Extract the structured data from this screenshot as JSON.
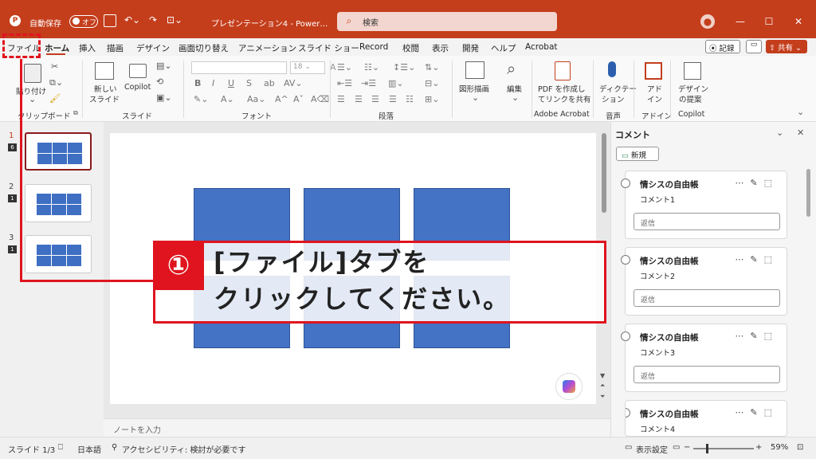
{
  "titlebar": {
    "autosave_label": "自動保存",
    "autosave_state": "オフ",
    "doc_title": "プレゼンテーション4 - Power…",
    "search_placeholder": "検索"
  },
  "tabs": [
    "ファイル",
    "ホーム",
    "挿入",
    "描画",
    "デザイン",
    "画面切り替え",
    "アニメーション",
    "スライド ショー",
    "Record",
    "校閲",
    "表示",
    "開発",
    "ヘルプ",
    "Acrobat"
  ],
  "tab_actions": {
    "record": "記録",
    "share": "共有"
  },
  "ribbon": {
    "paste": "貼り付け",
    "clipboard_group": "クリップボード",
    "new_slide": "新しい",
    "new_slide2": "スライド",
    "copilot": "Copilot",
    "slides_group": "スライド",
    "font_size": "18",
    "font_group": "フォント",
    "paragraph_group": "段落",
    "shape_draw": "図形描画",
    "edit": "編集",
    "pdf1": "PDF を作成し",
    "pdf2": "てリンクを共有",
    "acrobat_group": "Adobe Acrobat",
    "dictate1": "ディクテー",
    "dictate2": "ション",
    "voice_group": "音声",
    "addin1": "アド",
    "addin2": "イン",
    "addin_group": "アドイン",
    "designer1": "デザイン",
    "designer2": "の提案",
    "copilot_group": "Copilot"
  },
  "thumbnails": [
    {
      "num": "1",
      "comments": "6"
    },
    {
      "num": "2",
      "comments": "1"
    },
    {
      "num": "3",
      "comments": "1"
    }
  ],
  "notes_placeholder": "ノートを入力",
  "comments_panel": {
    "title": "コメント",
    "new_button": "新規",
    "reply_placeholder": "返信",
    "cards": [
      {
        "author": "情シスの自由帳",
        "text": "コメント1"
      },
      {
        "author": "情シスの自由帳",
        "text": "コメント2"
      },
      {
        "author": "情シスの自由帳",
        "text": "コメント3"
      },
      {
        "author": "情シスの自由帳",
        "text": "コメント4"
      }
    ]
  },
  "callout": {
    "number": "①",
    "line1": "[ファイル]タブを",
    "line2": "クリックしてください。"
  },
  "statusbar": {
    "slide_info": "スライド 1/3",
    "language": "日本語",
    "accessibility": "アクセシビリティ: 検討が必要です",
    "display_settings": "表示設定",
    "zoom": "59%"
  },
  "colors": {
    "accent": "#c43e1c",
    "highlight": "#e0141e",
    "shape": "#4472c4"
  }
}
